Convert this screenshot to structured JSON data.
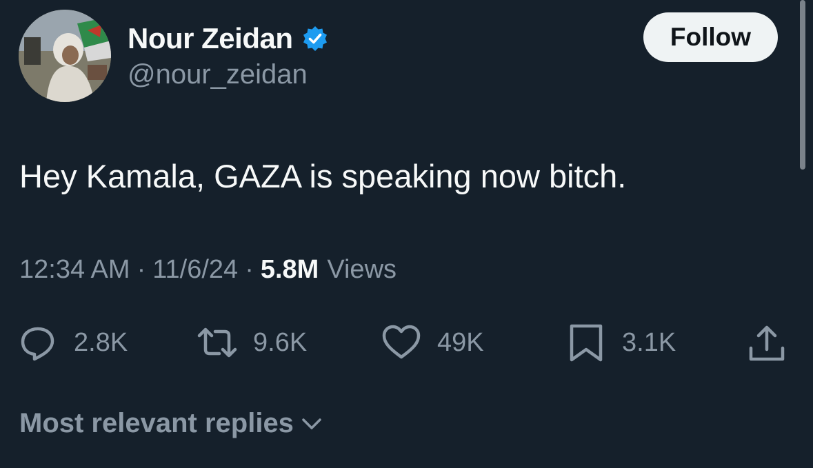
{
  "author": {
    "display_name": "Nour Zeidan",
    "handle": "@nour_zeidan",
    "verified": true,
    "avatar_icon": "profile-photo"
  },
  "follow_button": {
    "label": "Follow"
  },
  "tweet": {
    "text": "Hey Kamala, GAZA is speaking now bitch.",
    "time": "12:34 AM",
    "date": "11/6/24",
    "separator": "·",
    "views_count": "5.8M",
    "views_label": "Views"
  },
  "actions": {
    "reply": {
      "icon": "reply-bubble-icon",
      "count": "2.8K"
    },
    "retweet": {
      "icon": "retweet-icon",
      "count": "9.6K"
    },
    "like": {
      "icon": "heart-icon",
      "count": "49K"
    },
    "bookmark": {
      "icon": "bookmark-icon",
      "count": "3.1K"
    },
    "share": {
      "icon": "share-icon"
    }
  },
  "replies_sort": {
    "label": "Most relevant replies"
  },
  "colors": {
    "background": "#15202b",
    "primary_text": "#f7f9f9",
    "secondary_text": "#8b98a5",
    "verified_blue": "#1d9bf0",
    "follow_bg": "#eff3f4"
  }
}
